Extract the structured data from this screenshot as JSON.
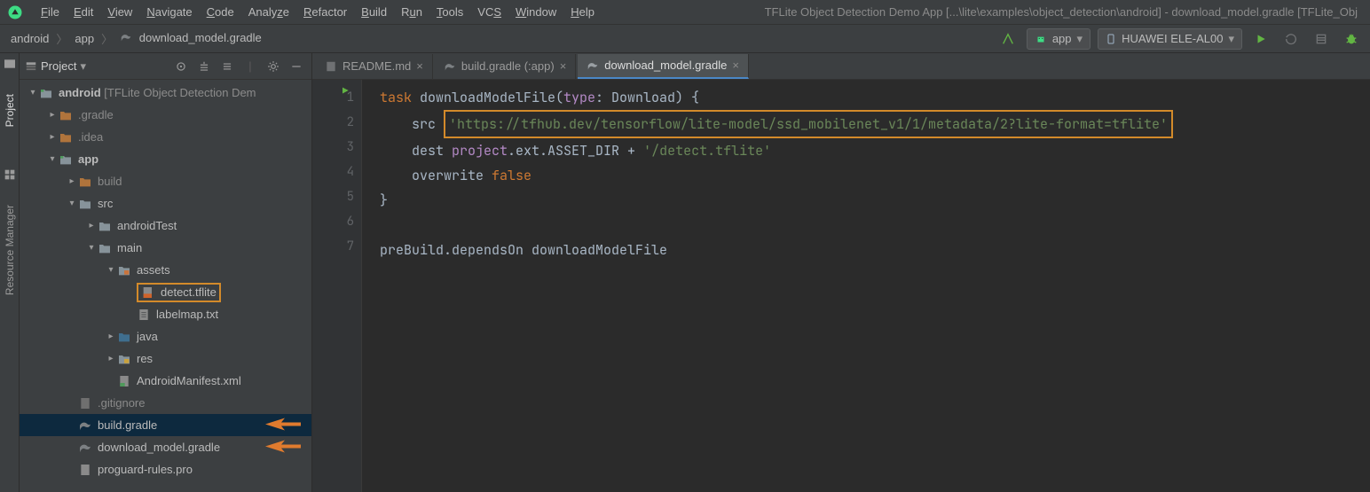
{
  "menubar": {
    "items": [
      "File",
      "Edit",
      "View",
      "Navigate",
      "Code",
      "Analyze",
      "Refactor",
      "Build",
      "Run",
      "Tools",
      "VCS",
      "Window",
      "Help"
    ],
    "title": "TFLite Object Detection Demo App [...\\lite\\examples\\object_detection\\android] - download_model.gradle [TFLite_Obj"
  },
  "breadcrumb": {
    "parts": [
      "android",
      "app",
      "download_model.gradle"
    ]
  },
  "toolbar": {
    "run_config": "app",
    "device": "HUAWEI ELE-AL00"
  },
  "left_tabs": {
    "project": "Project",
    "resource_manager": "Resource Manager"
  },
  "project_pane": {
    "title": "Project"
  },
  "tree": {
    "root_label": "android",
    "root_extra": " [TFLite Object Detection Dem",
    "gradle": ".gradle",
    "idea": ".idea",
    "app": "app",
    "build": "build",
    "src": "src",
    "androidTest": "androidTest",
    "main": "main",
    "assets": "assets",
    "detect": "detect.tflite",
    "labelmap": "labelmap.txt",
    "java": "java",
    "res": "res",
    "manifest": "AndroidManifest.xml",
    "gitignore": ".gitignore",
    "build_gradle": "build.gradle",
    "download_gradle": "download_model.gradle",
    "proguard": "proguard-rules.pro"
  },
  "tabs": {
    "readme": "README.md",
    "build_app": "build.gradle (:app)",
    "download": "download_model.gradle"
  },
  "code": {
    "l1_a": "task ",
    "l1_b": "downloadModelFile(",
    "l1_c": "type",
    "l1_d": ": Download) {",
    "l2_a": "src ",
    "l2_url": "'https://tfhub.dev/tensorflow/lite-model/ssd_mobilenet_v1/1/metadata/2?lite-format=tflite'",
    "l3_a": "dest ",
    "l3_b": "project",
    "l3_c": ".ext.ASSET_DIR + ",
    "l3_d": "'/detect.tflite'",
    "l4_a": "overwrite ",
    "l4_b": "false",
    "l5": "}",
    "l7": "preBuild.dependsOn downloadModelFile"
  },
  "gutter": [
    "1",
    "2",
    "3",
    "4",
    "5",
    "6",
    "7"
  ]
}
